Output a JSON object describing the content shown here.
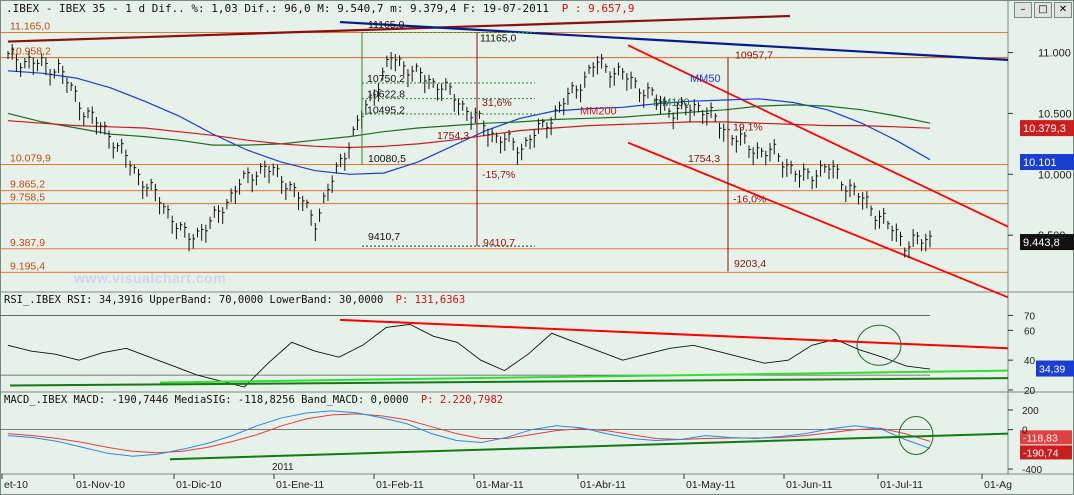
{
  "header": {
    "price": ".IBEX - IBEX 35 - 1 d Dif.. %: 1,03 Dif.: 96,0 M: 9.540,7 m: 9.379,4 F: 19-07-2011",
    "price_p": "P : 9.657,9",
    "rsi": "RSI_.IBEX RSI: 34,3916 UpperBand: 70,0000 LowerBand: 30,0000",
    "rsi_p": "P: 131,6363",
    "macd": "MACD_.IBEX MACD: -190,7446 MediaSIG: -118,8256 Band_MACD: 0,0000",
    "macd_p": "P: 2.220,7982"
  },
  "watermark": "www.visualchart.com",
  "window_buttons": [
    "–",
    "□",
    "✕"
  ],
  "colors": {
    "bg": "#e6f1ea",
    "border": "#7a8a80",
    "level_line": "#e2661e",
    "label_text": "#c04a10",
    "price_bar": "#111111",
    "mm50": "#1a3fd0",
    "mm100": "#1e6e22",
    "mm200": "#c81e1e",
    "channel": "#ff0000",
    "resistance": "#8b1010",
    "blue_trend": "#0a1a8a",
    "rsi_line": "#111111",
    "rsi_res": "#ff0000",
    "rsi_sup1": "#33dd33",
    "rsi_sup2": "#137a13",
    "macd_line": "#2f88e0",
    "macd_sig": "#e04040",
    "macd_trend": "#137a13"
  },
  "chart_data": [
    {
      "type": "candlestick",
      "name": "IBEX 35",
      "ylim": [
        9050,
        11300
      ],
      "y_ticks": [
        "11.000",
        "10.500",
        "10.000",
        "9.500"
      ],
      "y_tick_values": [
        11000,
        10500,
        10000,
        9500
      ],
      "last_values": [
        {
          "label": "10.379,3",
          "value": 10379.3,
          "color": "#c81e1e",
          "text": "#ffffff"
        },
        {
          "label": "10.101",
          "value": 10101,
          "color": "#1a3fd0",
          "text": "#ffffff"
        },
        {
          "label": "9.443,8",
          "value": 9443.8,
          "color": "#111111",
          "text": "#ffffff"
        }
      ],
      "levels": [
        {
          "label": "11.165,0",
          "value": 11165.0
        },
        {
          "label": "10.958,2",
          "value": 10958.2
        },
        {
          "label": "10.079,9",
          "value": 10079.9
        },
        {
          "label": "9.865,2",
          "value": 9865.2
        },
        {
          "label": "9.758,5",
          "value": 9758.5
        },
        {
          "label": "9.387,9",
          "value": 9387.9
        },
        {
          "label": "9.195,4",
          "value": 9195.4
        }
      ],
      "moving_averages": [
        {
          "name": "MM50",
          "label": "MM50",
          "values": [
            10850,
            10830,
            10790,
            10710,
            10600,
            10480,
            10330,
            10200,
            10100,
            10030,
            10000,
            10010,
            10100,
            10230,
            10360,
            10460,
            10520,
            10540,
            10550,
            10580,
            10600,
            10610,
            10620,
            10590,
            10530,
            10420,
            10280,
            10120
          ]
        },
        {
          "name": "MM100",
          "label": "MM100",
          "values": [
            10500,
            10430,
            10380,
            10330,
            10310,
            10280,
            10240,
            10240,
            10250,
            10280,
            10310,
            10350,
            10380,
            10400,
            10420,
            10430,
            10450,
            10460,
            10470,
            10490,
            10510,
            10530,
            10560,
            10570,
            10560,
            10530,
            10480,
            10420
          ]
        },
        {
          "name": "MM200",
          "label": "MM200",
          "values": [
            10440,
            10420,
            10400,
            10390,
            10380,
            10350,
            10320,
            10280,
            10250,
            10230,
            10220,
            10230,
            10250,
            10280,
            10320,
            10360,
            10380,
            10400,
            10410,
            10420,
            10430,
            10430,
            10420,
            10410,
            10400,
            10400,
            10390,
            10379
          ]
        }
      ],
      "close_series": [
        10950,
        10900,
        10850,
        10500,
        10300,
        10000,
        9750,
        9450,
        9600,
        9900,
        10050,
        9900,
        9600,
        10100,
        10550,
        10950,
        10800,
        10700,
        10500,
        10300,
        10200,
        10400,
        10650,
        10900,
        10800,
        10650,
        10500,
        10550,
        10350,
        10200,
        10150,
        9950,
        10050,
        9850,
        9650,
        9420,
        9444
      ],
      "annotations": [
        {
          "label": "11165,0",
          "value": 11165.0
        },
        {
          "label": "11165,0",
          "value": 11165.0
        },
        {
          "label": "10750,2",
          "value": 10750.2
        },
        {
          "label": "10622,8",
          "value": 10622.8
        },
        {
          "label": "10495,2",
          "value": 10495.2
        },
        {
          "label": "10080,5",
          "value": 10080.5
        },
        {
          "label": "1754,3",
          "value": 1754.3
        },
        {
          "label": "-15,7%",
          "value": -15.7
        },
        {
          "label": "9410,7",
          "value": 9410.7
        },
        {
          "label": "9410,7",
          "value": 9410.7
        },
        {
          "label": "31,6%",
          "value": 31.6
        },
        {
          "label": "10957,7",
          "value": 10957.7
        },
        {
          "label": "19,1%",
          "value": 19.1
        },
        {
          "label": "1754,3",
          "value": 1754.3
        },
        {
          "label": "-16,0%",
          "value": -16.0
        },
        {
          "label": "9203,4",
          "value": 9203.4
        }
      ],
      "x_tick_labels": [
        "et-10",
        "01-Nov-10",
        "01-Dic-10",
        "01-Ene-11",
        "01-Feb-11",
        "01-Mar-11",
        "01-Abr-11",
        "01-May-11",
        "01-Jun-11",
        "01-Jul-11",
        "01-Ag"
      ],
      "year_marker": "2011"
    },
    {
      "type": "line",
      "name": "RSI",
      "ylim": [
        20,
        75
      ],
      "y_ticks": [
        "70",
        "60",
        "40",
        "20"
      ],
      "y_tick_values": [
        70,
        60,
        40,
        20
      ],
      "bands": {
        "upper": 70,
        "lower": 30
      },
      "last_value": {
        "label": "34,39",
        "value": 34.39
      },
      "values": [
        50,
        46,
        44,
        40,
        45,
        48,
        42,
        36,
        30,
        26,
        22,
        38,
        52,
        46,
        42,
        50,
        62,
        64,
        56,
        52,
        40,
        33,
        44,
        58,
        52,
        46,
        40,
        44,
        48,
        50,
        46,
        42,
        38,
        40,
        50,
        54,
        47,
        42,
        36,
        34
      ]
    },
    {
      "type": "line",
      "name": "MACD",
      "ylim": [
        -430,
        230
      ],
      "y_ticks": [
        "200",
        "0",
        "-400"
      ],
      "y_tick_values": [
        200,
        0,
        -400
      ],
      "last_values": [
        {
          "label": "-118,83",
          "value": -118.83
        },
        {
          "label": "-190,74",
          "value": -190.74
        }
      ],
      "macd": [
        -60,
        -80,
        -120,
        -180,
        -240,
        -270,
        -250,
        -200,
        -140,
        -60,
        40,
        120,
        170,
        190,
        170,
        120,
        60,
        -40,
        -110,
        -130,
        -80,
        0,
        40,
        20,
        -40,
        -90,
        -110,
        -100,
        -60,
        -80,
        -90,
        -70,
        -40,
        10,
        40,
        10,
        -100,
        -190
      ],
      "signal": [
        -40,
        -60,
        -90,
        -130,
        -180,
        -220,
        -235,
        -220,
        -180,
        -120,
        -50,
        40,
        110,
        150,
        160,
        140,
        100,
        30,
        -40,
        -90,
        -90,
        -50,
        -10,
        10,
        -10,
        -50,
        -90,
        -100,
        -90,
        -85,
        -85,
        -80,
        -60,
        -30,
        0,
        15,
        -40,
        -119
      ]
    }
  ]
}
